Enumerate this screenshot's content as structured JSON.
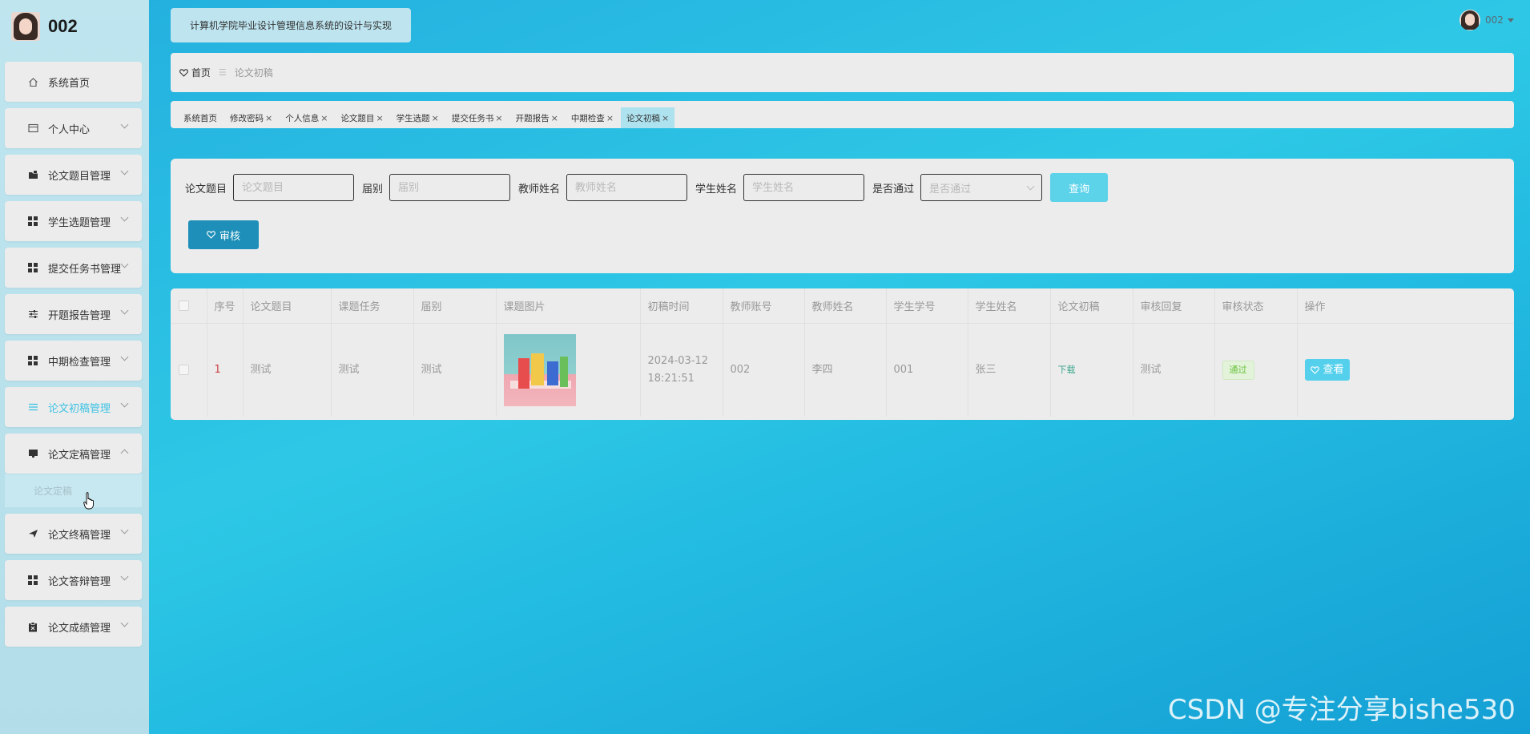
{
  "user": {
    "name": "002"
  },
  "system_title": "计算机学院毕业设计管理信息系统的设计与实现",
  "sidebar": {
    "items": [
      {
        "label": "系统首页",
        "icon": "home-icon",
        "expandable": false
      },
      {
        "label": "个人中心",
        "icon": "card-icon",
        "expandable": true
      },
      {
        "label": "论文题目管理",
        "icon": "folder-icon",
        "expandable": true
      },
      {
        "label": "学生选题管理",
        "icon": "grid-icon",
        "expandable": true
      },
      {
        "label": "提交任务书管理",
        "icon": "grid-icon",
        "expandable": true
      },
      {
        "label": "开题报告管理",
        "icon": "sliders-icon",
        "expandable": true
      },
      {
        "label": "中期检查管理",
        "icon": "grid-icon",
        "expandable": true
      },
      {
        "label": "论文初稿管理",
        "icon": "list-icon",
        "expandable": true,
        "active": true
      },
      {
        "label": "论文定稿管理",
        "icon": "monitor-icon",
        "expandable": true,
        "expanded": true,
        "submenu": [
          "论文定稿"
        ]
      },
      {
        "label": "论文终稿管理",
        "icon": "send-icon",
        "expandable": true
      },
      {
        "label": "论文答辩管理",
        "icon": "grid-icon",
        "expandable": true
      },
      {
        "label": "论文成绩管理",
        "icon": "clipboard-icon",
        "expandable": true
      }
    ]
  },
  "breadcrumb": {
    "home": "首页",
    "current": "论文初稿"
  },
  "tabs": [
    {
      "label": "系统首页",
      "closable": false
    },
    {
      "label": "修改密码",
      "closable": true
    },
    {
      "label": "个人信息",
      "closable": true
    },
    {
      "label": "论文题目",
      "closable": true
    },
    {
      "label": "学生选题",
      "closable": true
    },
    {
      "label": "提交任务书",
      "closable": true
    },
    {
      "label": "开题报告",
      "closable": true
    },
    {
      "label": "中期检查",
      "closable": true
    },
    {
      "label": "论文初稿",
      "closable": true,
      "active": true
    }
  ],
  "search": {
    "fields": [
      {
        "label": "论文题目",
        "placeholder": "论文题目"
      },
      {
        "label": "届别",
        "placeholder": "届别"
      },
      {
        "label": "教师姓名",
        "placeholder": "教师姓名"
      },
      {
        "label": "学生姓名",
        "placeholder": "学生姓名"
      }
    ],
    "pass_label": "是否通过",
    "pass_placeholder": "是否通过",
    "query_button": "查询",
    "audit_button": "审核"
  },
  "table": {
    "columns": [
      "序号",
      "论文题目",
      "课题任务",
      "届别",
      "课题图片",
      "初稿时间",
      "教师账号",
      "教师姓名",
      "学生学号",
      "学生姓名",
      "论文初稿",
      "审核回复",
      "审核状态",
      "操作"
    ],
    "rows": [
      {
        "index": "1",
        "title": "测试",
        "task": "测试",
        "session": "测试",
        "time": "2024-03-12 18:21:51",
        "teacher_account": "002",
        "teacher_name": "李四",
        "student_no": "001",
        "student_name": "张三",
        "draft": "下载",
        "reply": "测试",
        "status": "通过",
        "action": "查看"
      }
    ]
  },
  "watermark": "CSDN @专注分享bishe530",
  "colors": {
    "accent": "#3ec3e4",
    "primary_button": "#1d8fb8",
    "query_button": "#5dd3ea",
    "status_ok": "#67c23a"
  }
}
